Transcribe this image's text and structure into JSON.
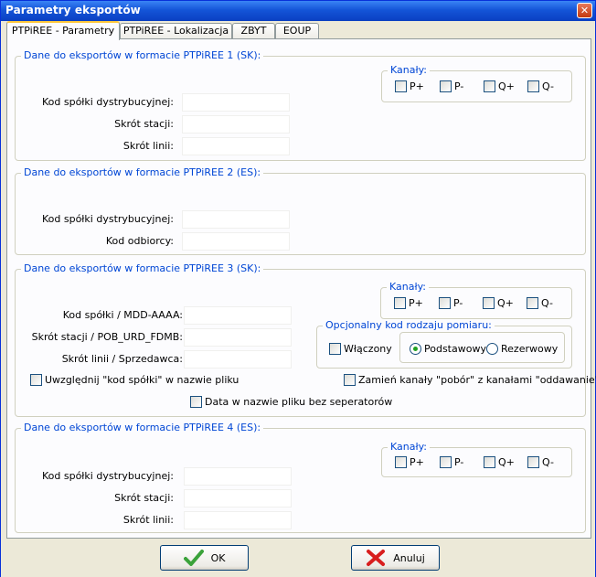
{
  "window": {
    "title": "Parametry eksportów"
  },
  "tabs": [
    {
      "label": "PTPiREE - Parametry"
    },
    {
      "label": "PTPiREE - Lokalizacja"
    },
    {
      "label": "ZBYT"
    },
    {
      "label": "EOUP"
    }
  ],
  "group1": {
    "title": "Dane do eksportów w formacie PTPiREE 1 (SK):",
    "labels": [
      "Kod spółki dystrybucyjnej:",
      "Skrót stacji:",
      "Skrót linii:"
    ],
    "values": [
      "",
      "",
      ""
    ],
    "channels": {
      "title": "Kanały:",
      "items": [
        "P+",
        "P-",
        "Q+",
        "Q-"
      ]
    }
  },
  "group2": {
    "title": "Dane do eksportów w formacie PTPiREE 2 (ES):",
    "labels": [
      "Kod spółki dystrybucyjnej:",
      "Kod odbiorcy:"
    ],
    "values": [
      "",
      ""
    ]
  },
  "group3": {
    "title": "Dane do eksportów w formacie PTPiREE 3 (SK):",
    "labels": [
      "Kod spółki / MDD-AAAA:",
      "Skrót stacji / POB_URD_FDMB:",
      "Skrót linii / Sprzedawca:"
    ],
    "values": [
      "",
      "",
      ""
    ],
    "channels": {
      "title": "Kanały:",
      "items": [
        "P+",
        "P-",
        "Q+",
        "Q-"
      ]
    },
    "measure": {
      "title": "Opcjonalny kod rodzaju pomiaru:",
      "enabled": "Włączony",
      "basic": "Podstawowy",
      "reserve": "Rezerwowy"
    },
    "include_code": "Uwzględnij \"kod spółki\" w nazwie pliku",
    "swap_channels": "Zamień kanały \"pobór\" z kanałami \"oddawanie\"",
    "date_no_sep": "Data w nazwie pliku bez seperatorów"
  },
  "group4": {
    "title": "Dane do eksportów w formacie PTPiREE 4 (ES):",
    "labels": [
      "Kod spółki dystrybucyjnej:",
      "Skrót stacji:",
      "Skrót linii:"
    ],
    "values": [
      "",
      "",
      ""
    ],
    "channels": {
      "title": "Kanały:",
      "items": [
        "P+",
        "P-",
        "Q+",
        "Q-"
      ]
    }
  },
  "buttons": {
    "ok": "OK",
    "cancel": "Anuluj"
  }
}
